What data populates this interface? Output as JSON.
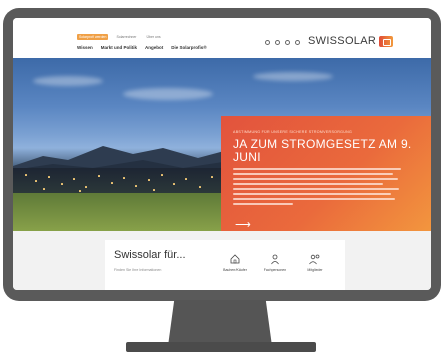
{
  "header": {
    "top_links": [
      "Solarprofi werden",
      "Solarrechner",
      "Über uns"
    ],
    "active_top_link": 0,
    "nav": [
      "Wissen",
      "Markt und Politik",
      "Angebot",
      "Die Solarprofis®"
    ],
    "icons": [
      "search-icon",
      "globe-icon",
      "lock-icon",
      "user-icon"
    ],
    "logo_text": "SWISSOLAR",
    "accent": "#f0a046"
  },
  "hero": {
    "eyebrow": "ABSTIMMUNG FÜR UNSERE SICHERE STROMVERSORGUNG",
    "title": "JA ZUM STROMGESETZ AM 9. JUNI",
    "arrow": "⟶",
    "card_colors": [
      "#e2533d",
      "#f39a3e"
    ]
  },
  "info": {
    "title": "Swissolar für...",
    "subtitle": "Finden Sie Ihre Informationen",
    "personas": [
      {
        "label": "Bauherr/Käufer",
        "icon": "house-icon"
      },
      {
        "label": "Fachpersonen",
        "icon": "worker-icon"
      },
      {
        "label": "Mitglieder",
        "icon": "group-icon"
      }
    ]
  }
}
